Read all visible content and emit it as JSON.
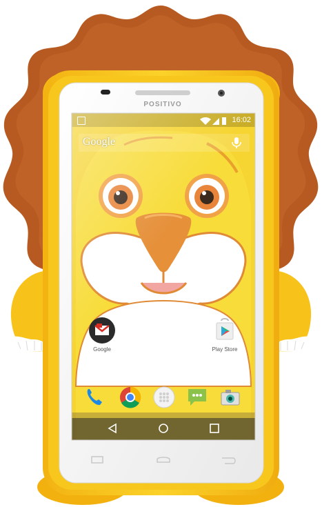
{
  "device": {
    "brand": "POSITIVO"
  },
  "status_bar": {
    "time": "16:02",
    "icons": [
      "photo-icon",
      "wifi-icon",
      "signal-icon",
      "battery-icon"
    ]
  },
  "search_bar": {
    "brand": "Google",
    "icon": "mic-icon"
  },
  "home_apps": [
    {
      "label": "Google",
      "icon": "gmail-folder-icon"
    },
    {
      "label": "Play Store",
      "icon": "play-store-icon"
    }
  ],
  "dock_apps": [
    {
      "icon": "phone-icon"
    },
    {
      "icon": "chrome-icon"
    },
    {
      "icon": "app-drawer-icon"
    },
    {
      "icon": "messaging-icon"
    },
    {
      "icon": "camera-icon"
    }
  ],
  "nav_bar": [
    "back-icon",
    "home-icon",
    "recents-icon"
  ],
  "colors": {
    "mane": "#b65a22",
    "case_yellow": "#f7c21a",
    "screen_yellow": "#f6d431",
    "muzzle": "#ffffff",
    "nose": "#e6903a"
  }
}
